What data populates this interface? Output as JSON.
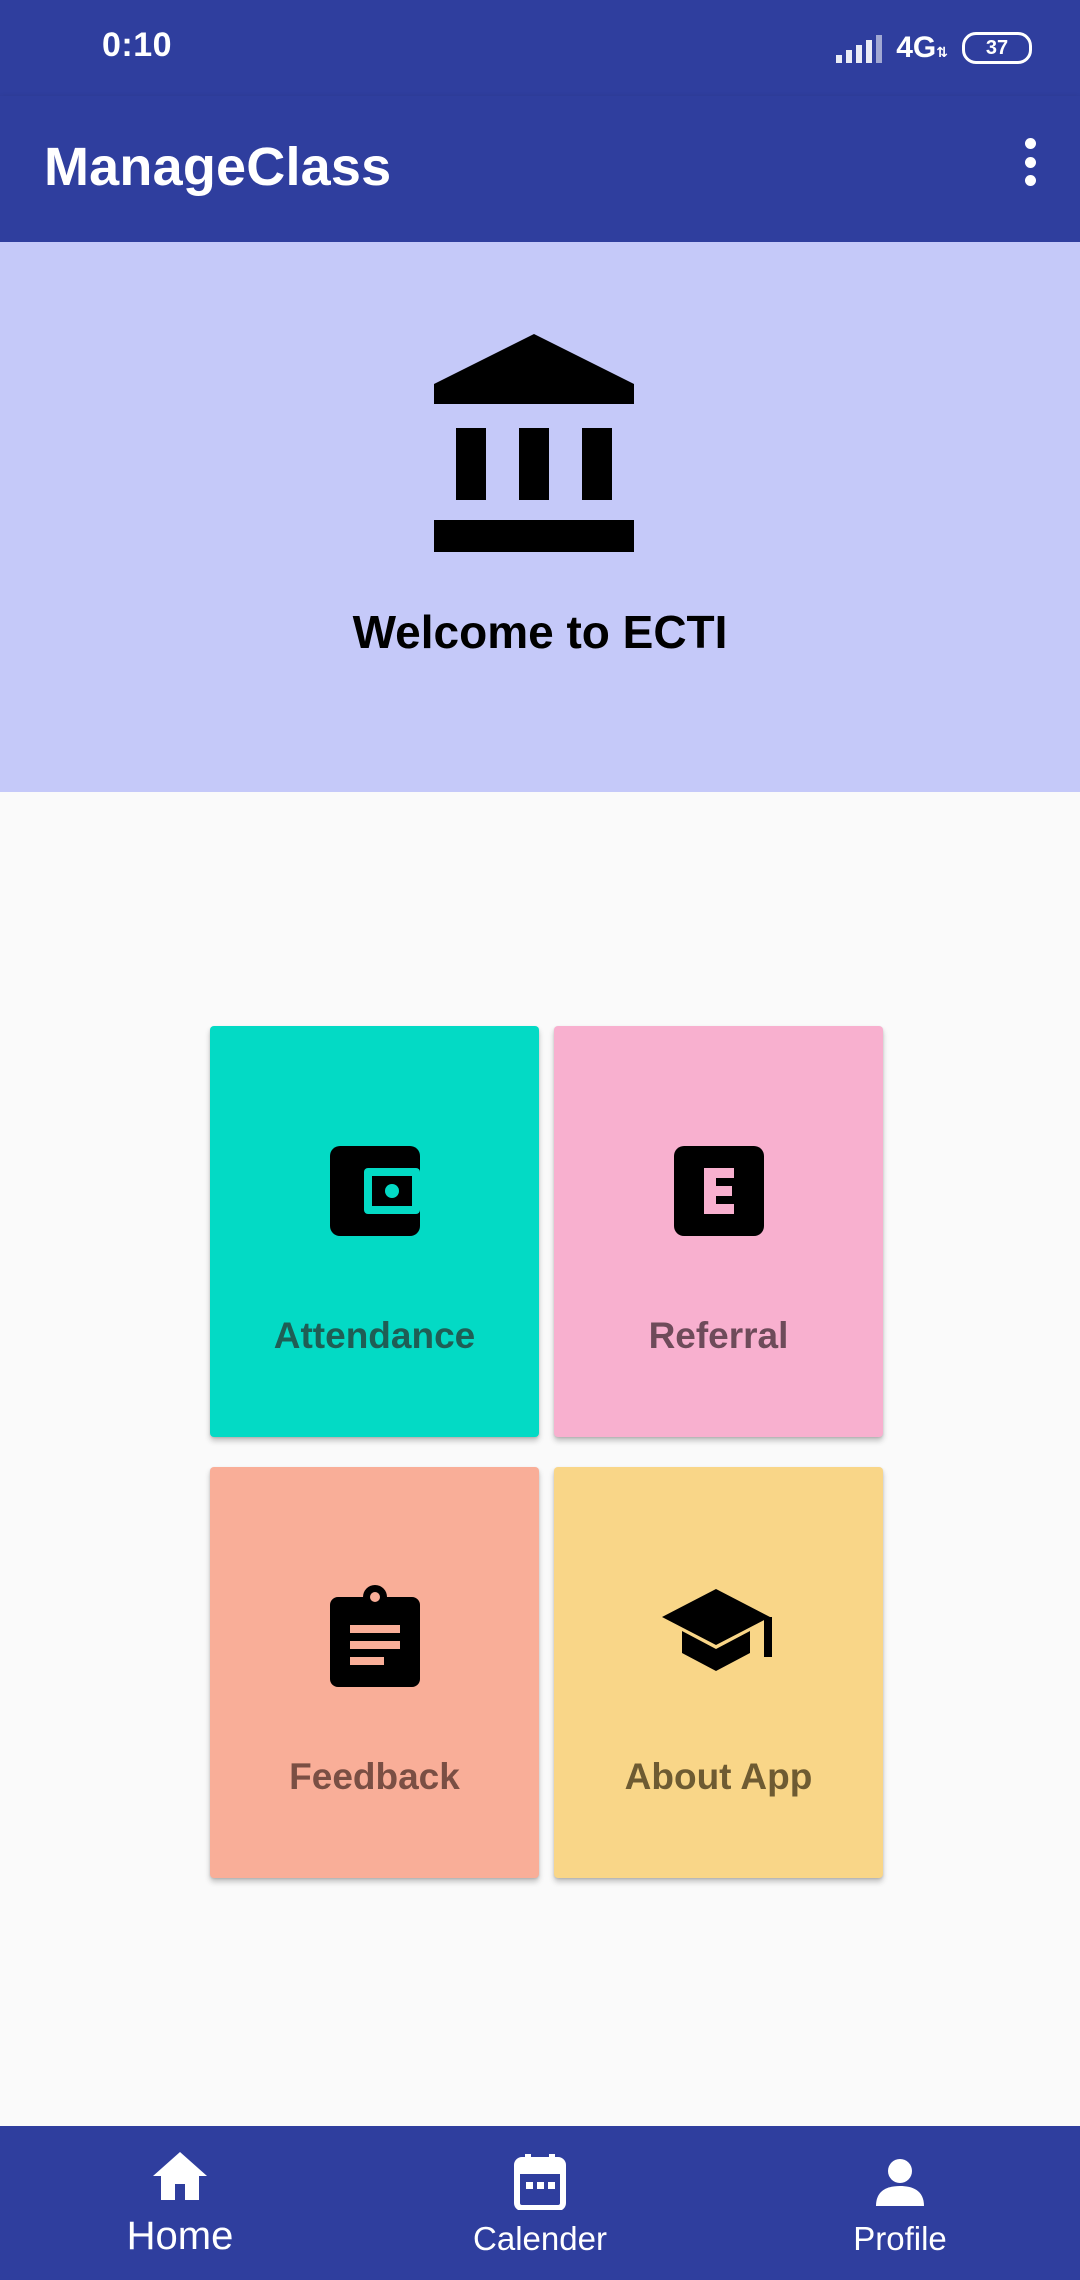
{
  "status_bar": {
    "time": "0:10",
    "network": "4G",
    "network_sub": "⇅",
    "battery": "37"
  },
  "app_bar": {
    "title": "ManageClass",
    "menu_icon": "more-vert-icon"
  },
  "hero": {
    "icon": "account-balance-icon",
    "welcome": "Welcome to ECTI"
  },
  "tiles": [
    {
      "label": "Attendance",
      "icon": "wallet-icon",
      "color": "#03dac5"
    },
    {
      "label": "Referral",
      "icon": "letter-e-icon",
      "color": "#f8b0cf"
    },
    {
      "label": "Feedback",
      "icon": "assignment-icon",
      "color": "#f9ae98"
    },
    {
      "label": "About App",
      "icon": "school-icon",
      "color": "#f9d688"
    }
  ],
  "bottom_nav": {
    "items": [
      {
        "label": "Home",
        "icon": "home-icon",
        "selected": true
      },
      {
        "label": "Calender",
        "icon": "calendar-icon",
        "selected": false
      },
      {
        "label": "Profile",
        "icon": "person-icon",
        "selected": false
      }
    ]
  },
  "colors": {
    "primary": "#2f3e9e",
    "hero_background": "#c5c9f9",
    "page_background": "#fafafa"
  }
}
